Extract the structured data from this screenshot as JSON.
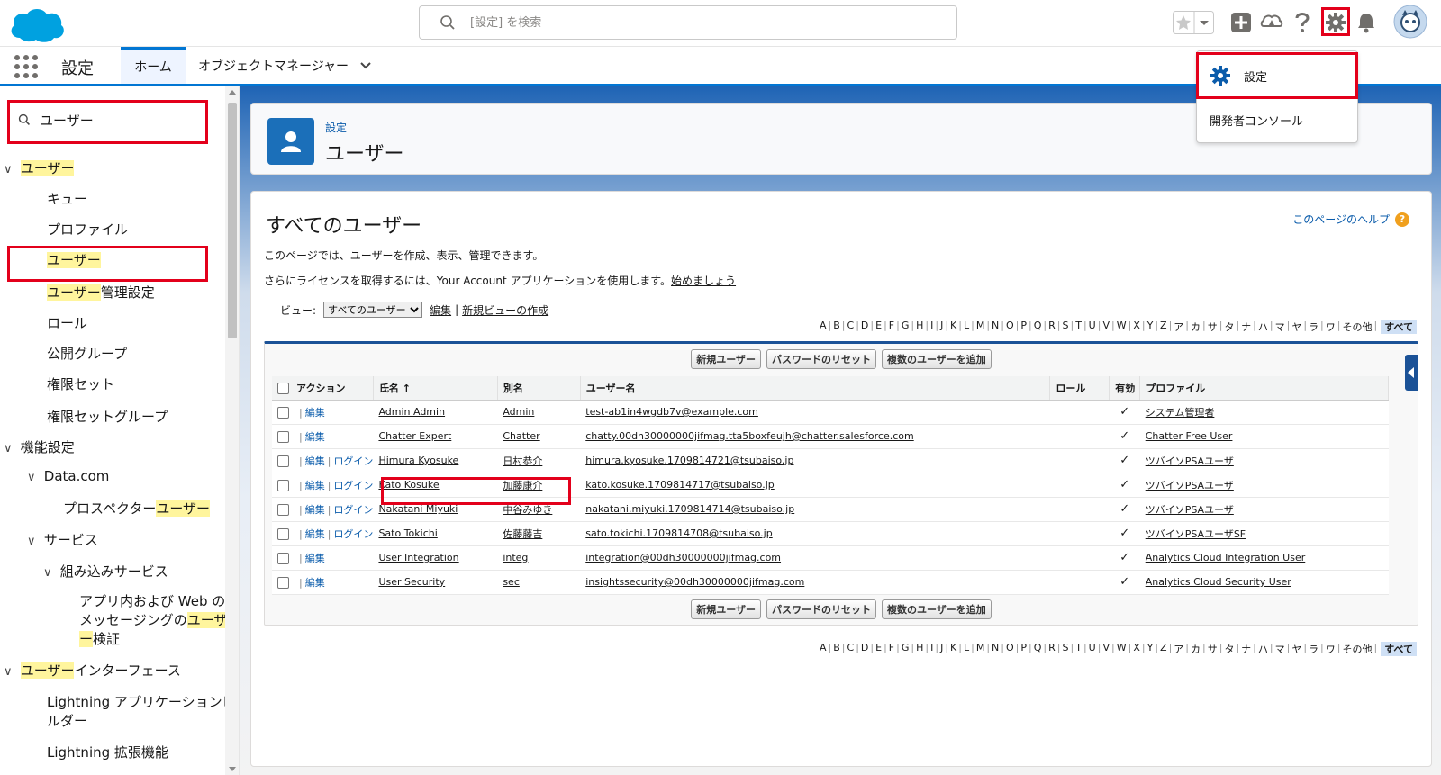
{
  "header": {
    "search_placeholder": "[設定] を検索"
  },
  "nav": {
    "app_name": "設定",
    "tabs": [
      {
        "label": "ホーム"
      },
      {
        "label": "オブジェクトマネージャー"
      }
    ]
  },
  "gear_menu": {
    "items": [
      {
        "label": "設定"
      },
      {
        "label": "開発者コンソール"
      }
    ]
  },
  "sidebar": {
    "quickfind_value": "ユーザー",
    "tree": [
      {
        "label_mark": "ユーザー",
        "label_rest": ""
      },
      {
        "label": "キュー"
      },
      {
        "label": "プロファイル"
      },
      {
        "label_mark": "ユーザー",
        "label_rest": ""
      },
      {
        "label_mark": "ユーザー",
        "label_rest": "管理設定"
      },
      {
        "label": "ロール"
      },
      {
        "label": "公開グループ"
      },
      {
        "label": "権限セット"
      },
      {
        "label": "権限セットグループ"
      },
      {
        "label": "機能設定"
      },
      {
        "label": "Data.com"
      },
      {
        "label_pre": "プロスペクター",
        "label_mark": "ユーザー"
      },
      {
        "label": "サービス"
      },
      {
        "label": "組み込みサービス"
      },
      {
        "label_l1": "アプリ内および Web の",
        "label_l2a": "メッセージングの",
        "label_l2b": "ユーザ",
        "label_l3a": "ー",
        "label_l3b": "検証"
      },
      {
        "label_mark": "ユーザー",
        "label_rest": "インターフェース"
      },
      {
        "label_l1": "Lightning アプリケーションビ",
        "label_l2": "ルダー"
      },
      {
        "label": "Lightning 拡張機能"
      }
    ]
  },
  "page": {
    "breadcrumb": "設定",
    "title": "ユーザー",
    "section_title": "すべてのユーザー",
    "help_link": "このページのヘルプ",
    "desc1": "このページでは、ユーザーを作成、表示、管理できます。",
    "desc2": "さらにライセンスを取得するには、Your Account アプリケーションを使用します。",
    "desc2_link": "始めましょう",
    "view_label": "ビュー:",
    "view_selected": "すべてのユーザー",
    "view_edit": "編集",
    "view_new": "新規ビューの作成",
    "alphabet": [
      "A",
      "B",
      "C",
      "D",
      "E",
      "F",
      "G",
      "H",
      "I",
      "J",
      "K",
      "L",
      "M",
      "N",
      "O",
      "P",
      "Q",
      "R",
      "S",
      "T",
      "U",
      "V",
      "W",
      "X",
      "Y",
      "Z",
      "ア",
      "カ",
      "サ",
      "タ",
      "ナ",
      "ハ",
      "マ",
      "ヤ",
      "ラ",
      "ワ",
      "その他"
    ],
    "alphabet_all": "すべて"
  },
  "buttons": {
    "new_user": "新規ユーザー",
    "reset_password": "パスワードのリセット",
    "add_multiple": "複数のユーザーを追加"
  },
  "table": {
    "headers": {
      "action": "アクション",
      "name": "氏名",
      "sort_arrow": "↑",
      "alias": "別名",
      "username": "ユーザー名",
      "role": "ロール",
      "active": "有効",
      "profile": "プロファイル"
    },
    "edit_label": "編集",
    "login_label": "ログイン",
    "active_mark": "✓",
    "rows": [
      {
        "name": "Admin Admin",
        "alias": "Admin",
        "username": "test-ab1in4wgdb7v@example.com",
        "role": "",
        "profile": "システム管理者",
        "login": false
      },
      {
        "name": "Chatter Expert",
        "alias": "Chatter",
        "username": "chatty.00dh30000000jifmag.tta5boxfeujh@chatter.salesforce.com",
        "role": "",
        "profile": "Chatter Free User",
        "login": false
      },
      {
        "name": "Himura Kyosuke",
        "alias": "日村恭介",
        "username": "himura.kyosuke.1709814721@tsubaiso.jp",
        "role": "",
        "profile": "ツバイソPSAユーザ",
        "login": true
      },
      {
        "name": "Kato Kosuke",
        "alias": "加藤康介",
        "username": "kato.kosuke.1709814717@tsubaiso.jp",
        "role": "",
        "profile": "ツバイソPSAユーザ",
        "login": true
      },
      {
        "name": "Nakatani Miyuki",
        "alias": "中谷みゆき",
        "username": "nakatani.miyuki.1709814714@tsubaiso.jp",
        "role": "",
        "profile": "ツバイソPSAユーザ",
        "login": true
      },
      {
        "name": "Sato Tokichi",
        "alias": "佐藤藤吉",
        "username": "sato.tokichi.1709814708@tsubaiso.jp",
        "role": "",
        "profile": "ツバイソPSAユーザSF",
        "login": true
      },
      {
        "name": "User Integration",
        "alias": "integ",
        "username": "integration@00dh30000000jifmag.com",
        "role": "",
        "profile": "Analytics Cloud Integration User",
        "login": false
      },
      {
        "name": "User Security",
        "alias": "sec",
        "username": "insightssecurity@00dh30000000jifmag.com",
        "role": "",
        "profile": "Analytics Cloud Security User",
        "login": false
      }
    ]
  },
  "colors": {
    "brand": "#0176d3",
    "highlight_box": "#e3001b",
    "search_mark": "#fff59d"
  }
}
